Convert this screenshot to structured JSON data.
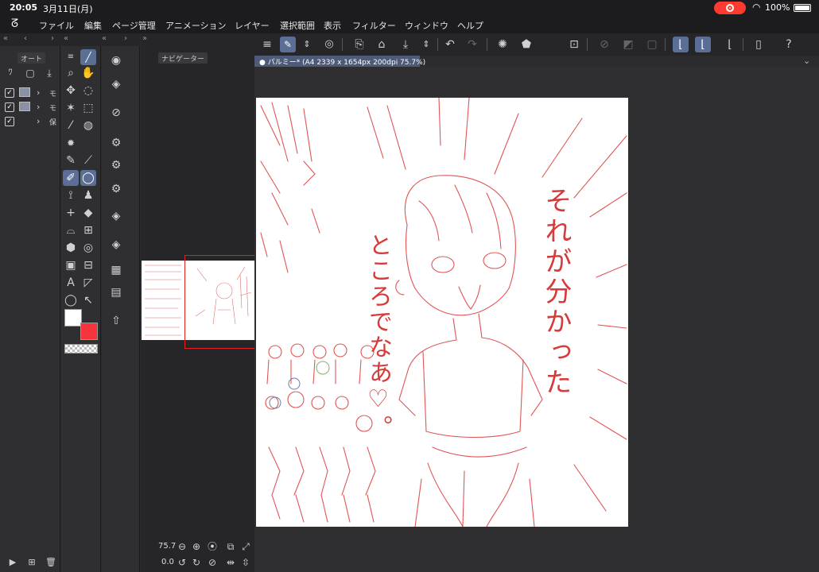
{
  "status": {
    "time": "20:05",
    "date": "3月11日(月)",
    "battery": "100%"
  },
  "menu": [
    "ファイル",
    "編集",
    "ページ管理",
    "アニメーション",
    "レイヤー",
    "選択範囲",
    "表示",
    "フィルター",
    "ウィンドウ",
    "ヘルプ"
  ],
  "panels": {
    "auto_tab": "オート",
    "navigator_tab": "ナビゲーター"
  },
  "layers": [
    {
      "label": "モ",
      "checked": true
    },
    {
      "label": "モ",
      "checked": true
    },
    {
      "label": "保",
      "checked": true
    }
  ],
  "canvas": {
    "tab_label": "● パルミー* (A4 2339 x 1654px 200dpi 75.7%)"
  },
  "navigator": {
    "zoom": "75.7",
    "rotation": "0.0"
  },
  "colors": {
    "main": "#ffffff",
    "sub": "#f5333b",
    "accent": "#5b6e95"
  },
  "drawing": {
    "vertical_text_1": "それが分かった",
    "vertical_text_2": "ところでなあ♡。"
  }
}
